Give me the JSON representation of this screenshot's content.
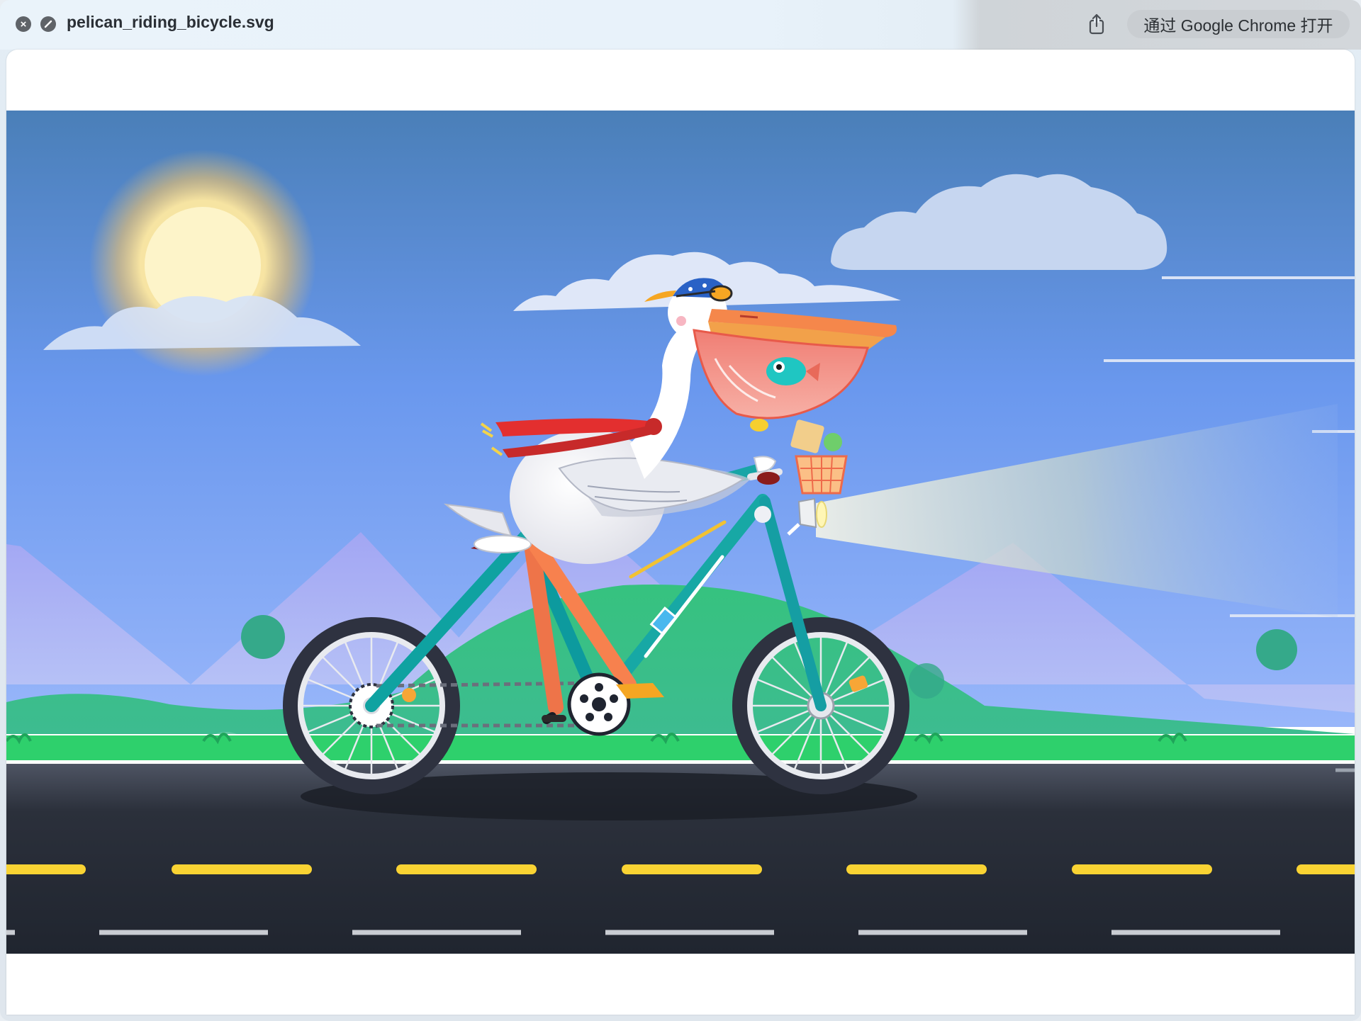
{
  "window": {
    "file_name": "pelican_riding_bicycle.svg",
    "open_with_label": "通过 Google Chrome 打开"
  },
  "icons": {
    "close": "close-icon",
    "block": "block-icon",
    "share": "share-icon"
  },
  "colors": {
    "sky_top": "#4a7fb8",
    "sky_bottom": "#8fb2f8",
    "mountain": "#a6a9f0",
    "hill": "#3fc77f",
    "grass": "#2fd36f",
    "road": "#262b35",
    "road_line_yellow": "#f9d333",
    "road_line_white": "#c9ccd2",
    "bike_frame": "#1aa4a6",
    "bike_frame_orange": "#f07b52",
    "scarf": "#e32f2f",
    "beak": "#f5874b",
    "sun": "#fdf4c9"
  }
}
